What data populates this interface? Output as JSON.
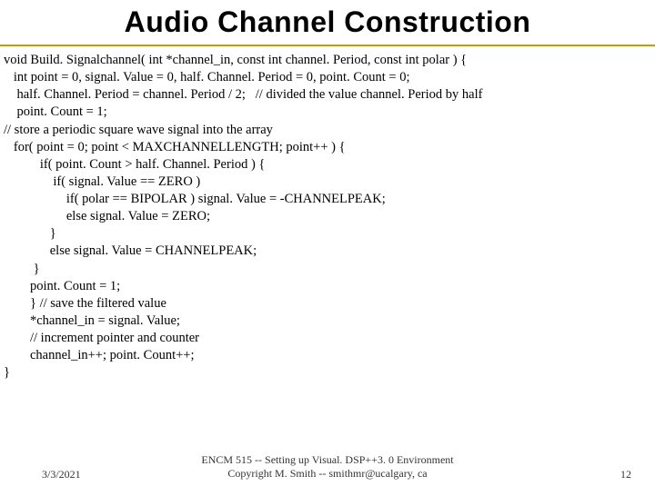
{
  "title": "Audio Channel Construction",
  "code": {
    "l01": "void Build. Signalchannel( int *channel_in, const int channel. Period, const int polar ) {",
    "l02": "   int point = 0, signal. Value = 0, half. Channel. Period = 0, point. Count = 0;",
    "l03": "    half. Channel. Period = channel. Period / 2;   // divided the value channel. Period by half",
    "l04": "    point. Count = 1;",
    "l05": "// store a periodic square wave signal into the array",
    "l06": "   for( point = 0; point < MAXCHANNELLENGTH; point++ ) {",
    "l07": "           if( point. Count > half. Channel. Period ) {",
    "l08": "               if( signal. Value == ZERO )",
    "l09": "                   if( polar == BIPOLAR ) signal. Value = -CHANNELPEAK;",
    "l10": "                   else signal. Value = ZERO;",
    "l11": "              }",
    "l12": "              else signal. Value = CHANNELPEAK;",
    "l13": "         }",
    "l14": "        point. Count = 1;",
    "l15": "        } // save the filtered value",
    "l16": "        *channel_in = signal. Value;",
    "l17": "        // increment pointer and counter",
    "l18": "        channel_in++; point. Count++;",
    "l19": "}"
  },
  "footer": {
    "date": "3/3/2021",
    "center1": "ENCM 515 -- Setting up Visual. DSP++3. 0 Environment",
    "center2": "Copyright M. Smith -- smithmr@ucalgary, ca",
    "page": "12"
  }
}
